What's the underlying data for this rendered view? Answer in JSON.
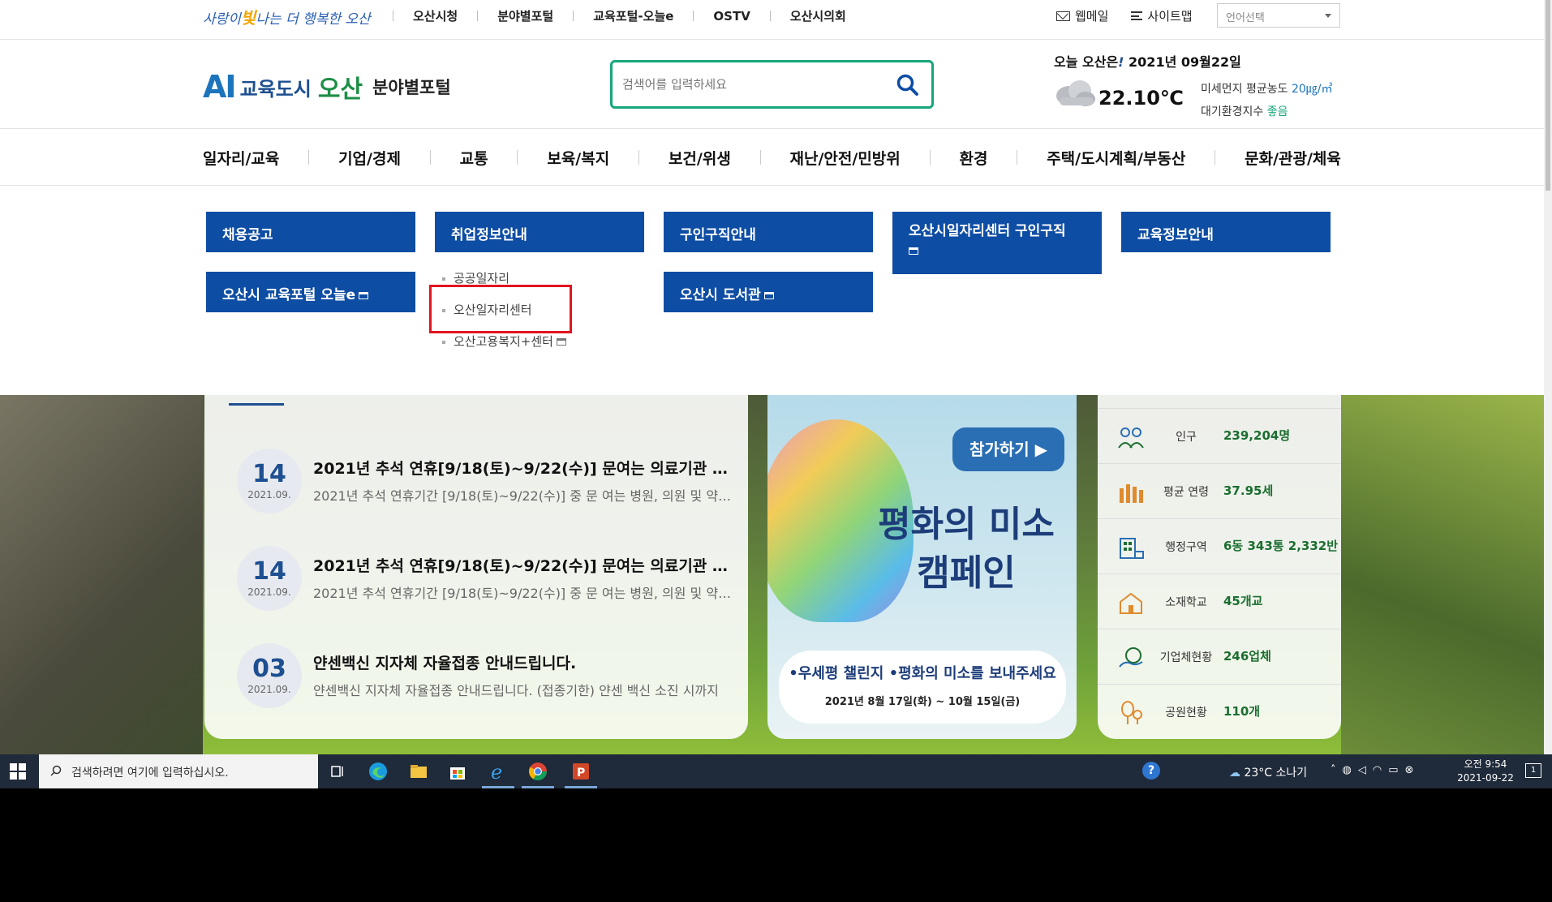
{
  "topbar": {
    "slogan_a": "사랑이",
    "slogan_b": "빛",
    "slogan_c": "나는 더 행복한 오산",
    "links": [
      "오산시청",
      "분야별포털",
      "교육포털-오늘e",
      "OSTV",
      "오산시의회"
    ],
    "webmail": "웹메일",
    "sitemap": "사이트맵",
    "language": "언어선택"
  },
  "header": {
    "logo_ai": "AI",
    "logo_edu": "교육도시",
    "logo_osan": "오산",
    "logo_portal": "분야별포털",
    "search_placeholder": "검색어를 입력하세요",
    "weather_title_a": "오늘 오산은",
    "weather_title_b": "!",
    "weather_date": " 2021년 09월22일",
    "temperature": "22.10℃",
    "dust_label": "미세먼지 평균농도 ",
    "dust_value": "20㎍/㎥",
    "air_label": "대기환경지수 ",
    "air_value": "좋음"
  },
  "gnb": [
    "일자리/교육",
    "기업/경제",
    "교통",
    "보육/복지",
    "보건/위생",
    "재난/안전/민방위",
    "환경",
    "주택/도시계획/부동산",
    "문화/관광/체육"
  ],
  "dropdown": {
    "buttons": [
      "채용공고",
      "취업정보안내",
      "구인구직안내",
      "오산시일자리센터 구인구직",
      "교육정보안내",
      "오산시 교육포털 오늘e",
      "오산시 도서관"
    ],
    "sub_items": [
      "공공일자리",
      "오산일자리센터",
      "오산고용복지+센터"
    ]
  },
  "news": [
    {
      "day": "14",
      "month": "2021.09.",
      "title": "2021년 추석 연휴[9/18(토)~9/22(수)] 문여는 의료기관 안내",
      "desc": "2021년 추석 연휴기간 [9/18(토)~9/22(수)] 중 문 여는 병원, 의원 및 약국 안내"
    },
    {
      "day": "14",
      "month": "2021.09.",
      "title": "2021년 추석 연휴[9/18(토)~9/22(수)] 문여는 의료기관 안내",
      "desc": "2021년 추석 연휴기간 [9/18(토)~9/22(수)] 중 문 여는 병원, 의원 및 약국 안내"
    },
    {
      "day": "03",
      "month": "2021.09.",
      "title": "얀센백신 지자체 자율접종 안내드립니다.",
      "desc": "얀센백신 지자체 자율접종 안내드립니다. (접종기한) 얀센 백신 소진 시까지"
    }
  ],
  "banner": {
    "join": "참가하기 ▶",
    "headline_1": "평화의 미소",
    "headline_2": "캠페인",
    "line1": "•우세평 챌린지  •평화의 미소를 보내주세요",
    "line2": "2021년 8월 17일(화) ~ 10월 15일(금)"
  },
  "stats": [
    {
      "label": "인구",
      "value": "239,204명",
      "icon": "people-icon"
    },
    {
      "label": "평균 연령",
      "value": "37.95세",
      "icon": "age-icon"
    },
    {
      "label": "행정구역",
      "value": "6동 343통 2,332반",
      "icon": "district-icon"
    },
    {
      "label": "소재학교",
      "value": "45개교",
      "icon": "school-icon"
    },
    {
      "label": "기업체현황",
      "value": "246업체",
      "icon": "company-icon"
    },
    {
      "label": "공원현황",
      "value": "110개",
      "icon": "park-icon"
    }
  ],
  "taskbar": {
    "search_placeholder": "검색하려면 여기에 입력하십시오.",
    "weather": "23°C  소나기",
    "time": "오전 9:54",
    "date": "2021-09-22",
    "notifications": "1"
  },
  "colors": {
    "primary_blue": "#0e4da4",
    "search_green": "#17a67c",
    "highlight_red": "#e0161f"
  }
}
